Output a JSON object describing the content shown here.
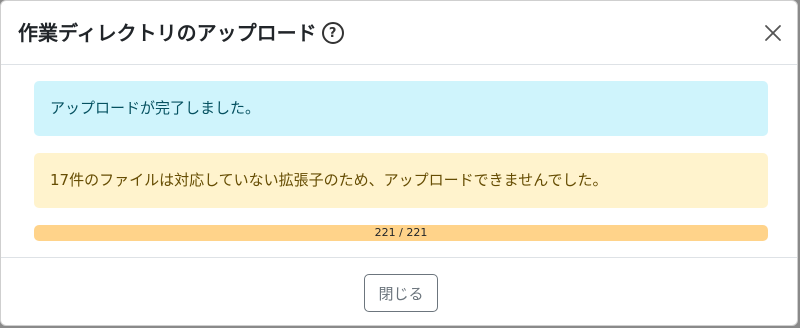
{
  "dialog": {
    "title": "作業ディレクトリのアップロード",
    "help_icon_glyph": "?",
    "close_icon": "close-x-icon"
  },
  "alerts": {
    "success_message": "アップロードが完了しました。",
    "warning_message": "17件のファイルは対応していない拡張子のため、アップロードできませんでした。"
  },
  "progress": {
    "label": "221 / 221",
    "percent": 100,
    "color": "#ffd38a"
  },
  "footer": {
    "close_label": "閉じる"
  },
  "colors": {
    "info_bg": "#cff4fc",
    "info_text": "#055160",
    "warning_bg": "#fff3cd",
    "warning_text": "#664d03"
  }
}
